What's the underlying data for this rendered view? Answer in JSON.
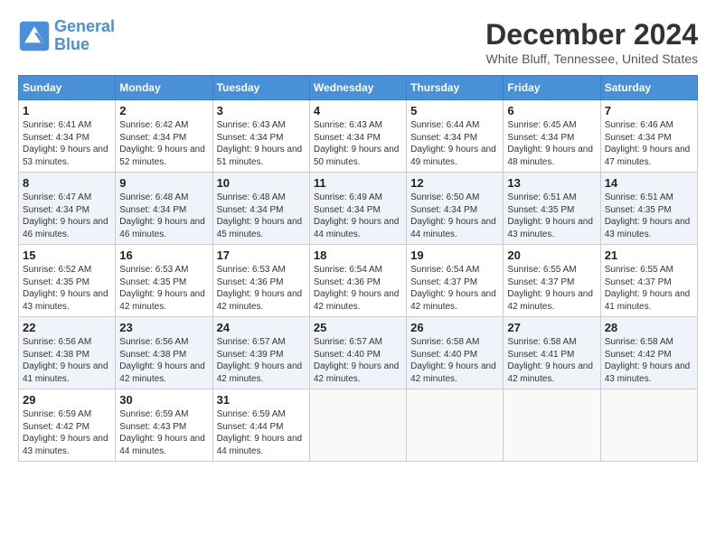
{
  "header": {
    "logo_line1": "General",
    "logo_line2": "Blue",
    "month": "December 2024",
    "location": "White Bluff, Tennessee, United States"
  },
  "weekdays": [
    "Sunday",
    "Monday",
    "Tuesday",
    "Wednesday",
    "Thursday",
    "Friday",
    "Saturday"
  ],
  "weeks": [
    [
      {
        "day": "1",
        "sunrise": "6:41 AM",
        "sunset": "4:34 PM",
        "daylight": "9 hours and 53 minutes."
      },
      {
        "day": "2",
        "sunrise": "6:42 AM",
        "sunset": "4:34 PM",
        "daylight": "9 hours and 52 minutes."
      },
      {
        "day": "3",
        "sunrise": "6:43 AM",
        "sunset": "4:34 PM",
        "daylight": "9 hours and 51 minutes."
      },
      {
        "day": "4",
        "sunrise": "6:43 AM",
        "sunset": "4:34 PM",
        "daylight": "9 hours and 50 minutes."
      },
      {
        "day": "5",
        "sunrise": "6:44 AM",
        "sunset": "4:34 PM",
        "daylight": "9 hours and 49 minutes."
      },
      {
        "day": "6",
        "sunrise": "6:45 AM",
        "sunset": "4:34 PM",
        "daylight": "9 hours and 48 minutes."
      },
      {
        "day": "7",
        "sunrise": "6:46 AM",
        "sunset": "4:34 PM",
        "daylight": "9 hours and 47 minutes."
      }
    ],
    [
      {
        "day": "8",
        "sunrise": "6:47 AM",
        "sunset": "4:34 PM",
        "daylight": "9 hours and 46 minutes."
      },
      {
        "day": "9",
        "sunrise": "6:48 AM",
        "sunset": "4:34 PM",
        "daylight": "9 hours and 46 minutes."
      },
      {
        "day": "10",
        "sunrise": "6:48 AM",
        "sunset": "4:34 PM",
        "daylight": "9 hours and 45 minutes."
      },
      {
        "day": "11",
        "sunrise": "6:49 AM",
        "sunset": "4:34 PM",
        "daylight": "9 hours and 44 minutes."
      },
      {
        "day": "12",
        "sunrise": "6:50 AM",
        "sunset": "4:34 PM",
        "daylight": "9 hours and 44 minutes."
      },
      {
        "day": "13",
        "sunrise": "6:51 AM",
        "sunset": "4:35 PM",
        "daylight": "9 hours and 43 minutes."
      },
      {
        "day": "14",
        "sunrise": "6:51 AM",
        "sunset": "4:35 PM",
        "daylight": "9 hours and 43 minutes."
      }
    ],
    [
      {
        "day": "15",
        "sunrise": "6:52 AM",
        "sunset": "4:35 PM",
        "daylight": "9 hours and 43 minutes."
      },
      {
        "day": "16",
        "sunrise": "6:53 AM",
        "sunset": "4:35 PM",
        "daylight": "9 hours and 42 minutes."
      },
      {
        "day": "17",
        "sunrise": "6:53 AM",
        "sunset": "4:36 PM",
        "daylight": "9 hours and 42 minutes."
      },
      {
        "day": "18",
        "sunrise": "6:54 AM",
        "sunset": "4:36 PM",
        "daylight": "9 hours and 42 minutes."
      },
      {
        "day": "19",
        "sunrise": "6:54 AM",
        "sunset": "4:37 PM",
        "daylight": "9 hours and 42 minutes."
      },
      {
        "day": "20",
        "sunrise": "6:55 AM",
        "sunset": "4:37 PM",
        "daylight": "9 hours and 42 minutes."
      },
      {
        "day": "21",
        "sunrise": "6:55 AM",
        "sunset": "4:37 PM",
        "daylight": "9 hours and 41 minutes."
      }
    ],
    [
      {
        "day": "22",
        "sunrise": "6:56 AM",
        "sunset": "4:38 PM",
        "daylight": "9 hours and 41 minutes."
      },
      {
        "day": "23",
        "sunrise": "6:56 AM",
        "sunset": "4:38 PM",
        "daylight": "9 hours and 42 minutes."
      },
      {
        "day": "24",
        "sunrise": "6:57 AM",
        "sunset": "4:39 PM",
        "daylight": "9 hours and 42 minutes."
      },
      {
        "day": "25",
        "sunrise": "6:57 AM",
        "sunset": "4:40 PM",
        "daylight": "9 hours and 42 minutes."
      },
      {
        "day": "26",
        "sunrise": "6:58 AM",
        "sunset": "4:40 PM",
        "daylight": "9 hours and 42 minutes."
      },
      {
        "day": "27",
        "sunrise": "6:58 AM",
        "sunset": "4:41 PM",
        "daylight": "9 hours and 42 minutes."
      },
      {
        "day": "28",
        "sunrise": "6:58 AM",
        "sunset": "4:42 PM",
        "daylight": "9 hours and 43 minutes."
      }
    ],
    [
      {
        "day": "29",
        "sunrise": "6:59 AM",
        "sunset": "4:42 PM",
        "daylight": "9 hours and 43 minutes."
      },
      {
        "day": "30",
        "sunrise": "6:59 AM",
        "sunset": "4:43 PM",
        "daylight": "9 hours and 44 minutes."
      },
      {
        "day": "31",
        "sunrise": "6:59 AM",
        "sunset": "4:44 PM",
        "daylight": "9 hours and 44 minutes."
      },
      null,
      null,
      null,
      null
    ]
  ]
}
